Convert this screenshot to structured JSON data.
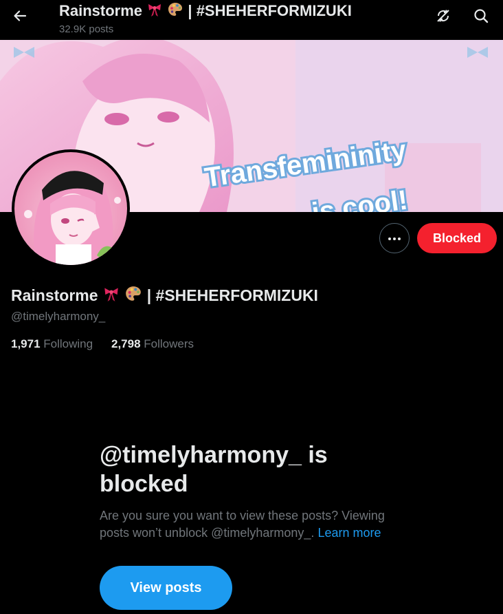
{
  "header": {
    "title_name": "Rainstorme",
    "title_rest": "| #SHEHERFORMIZUKI",
    "post_count": "32.9K posts"
  },
  "banner": {
    "text_line1": "Transfemininity",
    "text_line2": "is cool!"
  },
  "profile": {
    "display_name": "Rainstorme",
    "display_name_rest": "| #SHEHERFORMIZUKI",
    "handle": "@timelyharmony_",
    "following_count": "1,971",
    "following_label": "Following",
    "followers_count": "2,798",
    "followers_label": "Followers",
    "blocked_button": "Blocked"
  },
  "blocked_notice": {
    "heading": "@timelyharmony_ is blocked",
    "description": "Are you sure you want to view these posts? Viewing posts won’t unblock @timelyharmony_.",
    "learn_more": "Learn more",
    "view_button": "View posts"
  },
  "icons": {
    "back": "arrow-left-icon",
    "unlock": "no-sync-icon",
    "search": "search-icon",
    "more": "more-horizontal-icon",
    "bow": "ribbon-emoji",
    "palette": "palette-emoji"
  },
  "colors": {
    "background": "#000000",
    "primary_text": "#e7e9ea",
    "secondary_text": "#71767b",
    "accent_blue": "#1d9bf0",
    "blocked_red": "#f4212e"
  }
}
